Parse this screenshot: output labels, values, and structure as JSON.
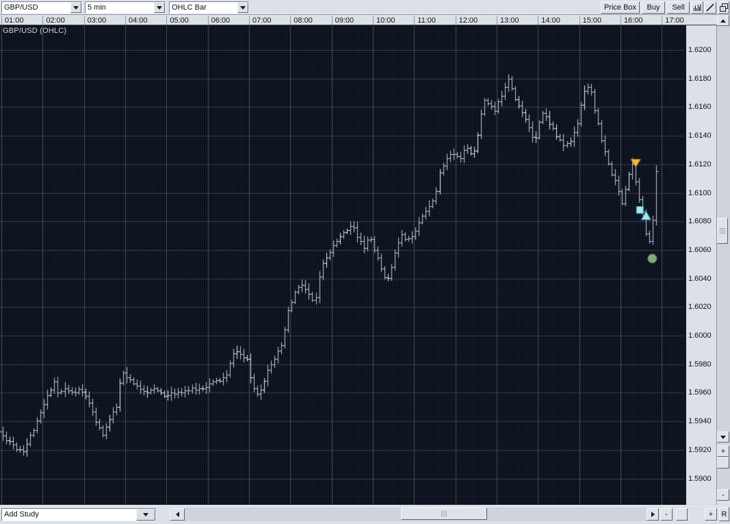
{
  "toolbar": {
    "symbol_combo": {
      "value": "GBP/USD"
    },
    "interval_combo": {
      "value": "5 min"
    },
    "chart_type_combo": {
      "value": "OHLC Bar"
    },
    "price_box_button": "Price Box",
    "buy_button": "Buy",
    "sell_button": "Sell",
    "icon_buttons": [
      "volume-study-icon",
      "trendline-icon",
      "cascade-windows-icon"
    ]
  },
  "chart": {
    "title": "GBP/USD (OHLC)"
  },
  "bottom_bar": {
    "add_study_combo": {
      "value": "Add Study"
    },
    "minus_button": "-",
    "plus_button": "+",
    "reset_button": "R"
  },
  "right_bar": {
    "plus_button": "+",
    "minus_button": "-"
  },
  "scroll_icons": [
    "scroll-up-icon",
    "scroll-down-icon",
    "scroll-left-icon",
    "scroll-right-icon"
  ],
  "chart_data": {
    "type": "ohlc-bar",
    "symbol": "GBP/USD",
    "interval": "5 min",
    "title": "GBP/USD (OHLC)",
    "bar_color": "#c4cada",
    "bar_color_bright": "#eef2fc",
    "grid": {
      "v_color": "rgba(120,145,120,0.50)",
      "h_color": "rgba(105,115,145,0.42)"
    },
    "x_axis": {
      "labels": [
        "01:00",
        "02:00",
        "03:00",
        "04:00",
        "05:00",
        "06:00",
        "07:00",
        "08:00",
        "09:00",
        "10:00",
        "11:00",
        "12:00",
        "13:00",
        "14:00",
        "15:00",
        "16:00",
        "17:00"
      ]
    },
    "y_axis": {
      "min": 1.589,
      "max": 1.6215,
      "tick_step": 0.002,
      "labels": [
        "1.6200",
        "1.6180",
        "1.6160",
        "1.6140",
        "1.6120",
        "1.6100",
        "1.6080",
        "1.6060",
        "1.6040",
        "1.6020",
        "1.6000",
        "1.5980",
        "1.5960",
        "1.5940",
        "1.5920",
        "1.5900"
      ]
    },
    "price_path": [
      [
        0.95,
        1.5934
      ],
      [
        1.1,
        1.5929
      ],
      [
        1.25,
        1.5926
      ],
      [
        1.42,
        1.5921
      ],
      [
        1.58,
        1.592
      ],
      [
        1.75,
        1.593
      ],
      [
        1.92,
        1.594
      ],
      [
        2.08,
        1.5952
      ],
      [
        2.25,
        1.5964
      ],
      [
        2.33,
        1.5968
      ],
      [
        2.42,
        1.5959
      ],
      [
        2.58,
        1.5963
      ],
      [
        2.75,
        1.596
      ],
      [
        2.92,
        1.5962
      ],
      [
        3.08,
        1.5958
      ],
      [
        3.25,
        1.5945
      ],
      [
        3.42,
        1.5934
      ],
      [
        3.5,
        1.5931
      ],
      [
        3.67,
        1.5942
      ],
      [
        3.83,
        1.595
      ],
      [
        3.95,
        1.5975
      ],
      [
        4.08,
        1.597
      ],
      [
        4.25,
        1.5966
      ],
      [
        4.42,
        1.5963
      ],
      [
        4.58,
        1.5961
      ],
      [
        4.75,
        1.5962
      ],
      [
        4.92,
        1.596
      ],
      [
        5.08,
        1.5958
      ],
      [
        5.33,
        1.5961
      ],
      [
        5.58,
        1.5962
      ],
      [
        5.83,
        1.5963
      ],
      [
        6.08,
        1.5966
      ],
      [
        6.33,
        1.5969
      ],
      [
        6.5,
        1.5972
      ],
      [
        6.67,
        1.599
      ],
      [
        6.83,
        1.5987
      ],
      [
        7.0,
        1.5982
      ],
      [
        7.08,
        1.597
      ],
      [
        7.21,
        1.5959
      ],
      [
        7.38,
        1.5965
      ],
      [
        7.5,
        1.5978
      ],
      [
        7.67,
        1.5985
      ],
      [
        7.83,
        1.5992
      ],
      [
        8.0,
        1.6018
      ],
      [
        8.17,
        1.6031
      ],
      [
        8.33,
        1.6036
      ],
      [
        8.5,
        1.6028
      ],
      [
        8.63,
        1.6022
      ],
      [
        8.79,
        1.6048
      ],
      [
        8.92,
        1.6055
      ],
      [
        9.08,
        1.6063
      ],
      [
        9.25,
        1.6069
      ],
      [
        9.42,
        1.6075
      ],
      [
        9.54,
        1.6079
      ],
      [
        9.67,
        1.6068
      ],
      [
        9.83,
        1.6062
      ],
      [
        9.96,
        1.607
      ],
      [
        10.13,
        1.6056
      ],
      [
        10.29,
        1.6043
      ],
      [
        10.42,
        1.6039
      ],
      [
        10.58,
        1.606
      ],
      [
        10.75,
        1.607
      ],
      [
        10.92,
        1.6067
      ],
      [
        11.08,
        1.6075
      ],
      [
        11.25,
        1.6086
      ],
      [
        11.42,
        1.609
      ],
      [
        11.54,
        1.6098
      ],
      [
        11.67,
        1.6115
      ],
      [
        11.83,
        1.6124
      ],
      [
        11.96,
        1.6128
      ],
      [
        12.13,
        1.6124
      ],
      [
        12.29,
        1.6131
      ],
      [
        12.46,
        1.6127
      ],
      [
        12.58,
        1.614
      ],
      [
        12.71,
        1.6166
      ],
      [
        12.87,
        1.6162
      ],
      [
        13.0,
        1.6157
      ],
      [
        13.17,
        1.617
      ],
      [
        13.33,
        1.6181
      ],
      [
        13.5,
        1.6166
      ],
      [
        13.67,
        1.6155
      ],
      [
        13.83,
        1.6146
      ],
      [
        13.96,
        1.6136
      ],
      [
        14.13,
        1.6157
      ],
      [
        14.29,
        1.6151
      ],
      [
        14.46,
        1.6142
      ],
      [
        14.63,
        1.6133
      ],
      [
        14.83,
        1.6136
      ],
      [
        15.0,
        1.615
      ],
      [
        15.13,
        1.6171
      ],
      [
        15.29,
        1.6176
      ],
      [
        15.42,
        1.6157
      ],
      [
        15.58,
        1.6136
      ],
      [
        15.75,
        1.6119
      ],
      [
        15.92,
        1.6107
      ],
      [
        16.08,
        1.6093
      ],
      [
        16.21,
        1.6111
      ],
      [
        16.33,
        1.6121
      ],
      [
        16.46,
        1.6101
      ],
      [
        16.58,
        1.6085
      ],
      [
        16.71,
        1.6063
      ],
      [
        16.79,
        1.6068
      ],
      [
        16.92,
        1.6119
      ]
    ],
    "markers": [
      {
        "shape": "triangle-down",
        "color": "#f5b942",
        "border": "#b98718",
        "time": 16.37,
        "price": 1.6121
      },
      {
        "shape": "square",
        "color": "#a6e8f2",
        "border": "#4fa8bc",
        "time": 16.47,
        "price": 1.6088
      },
      {
        "shape": "triangle-up",
        "color": "#a6e8f2",
        "border": "#4fa8bc",
        "time": 16.62,
        "price": 1.6084
      },
      {
        "shape": "circle",
        "color": "#7dab7d",
        "border": "#5d8a5d",
        "time": 16.77,
        "price": 1.6054
      }
    ]
  }
}
